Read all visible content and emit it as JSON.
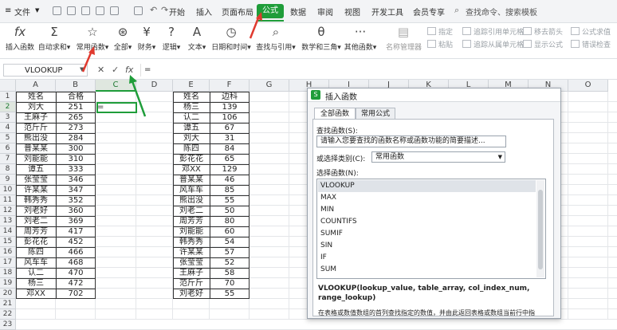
{
  "menu": {
    "file_label": "文件",
    "tabs": [
      "开始",
      "插入",
      "页面布局",
      "公式",
      "数据",
      "审阅",
      "视图",
      "开发工具",
      "会员专享"
    ],
    "search_placeholder": "查找命令、搜索模板"
  },
  "ribbon": {
    "buttons": [
      {
        "icon": "fx",
        "label": "插入函数"
      },
      {
        "icon": "Σ",
        "label": "自动求和▾"
      },
      {
        "icon": "☆",
        "label": "常用函数▾"
      },
      {
        "icon": "⊛",
        "label": "全部▾"
      },
      {
        "icon": "¥",
        "label": "财务▾"
      },
      {
        "icon": "?",
        "label": "逻辑▾"
      },
      {
        "icon": "A",
        "label": "文本▾"
      },
      {
        "icon": "◷",
        "label": "日期和时间▾"
      },
      {
        "icon": "⌕",
        "label": "查找与引用▾"
      },
      {
        "icon": "θ",
        "label": "数学和三角▾"
      },
      {
        "icon": "···",
        "label": "其他函数▾"
      },
      {
        "icon": "▤",
        "label": "名称管理器"
      }
    ],
    "small_buttons": [
      "指定",
      "追踪引用单元格",
      "移去箭头",
      "公式求值",
      "粘贴",
      "追踪从属单元格",
      "显示公式",
      "错误检查"
    ]
  },
  "formula_bar": {
    "name_box": "VLOOKUP",
    "cancel_symbol": "✕",
    "confirm_symbol": "✓",
    "fx_symbol": "fx",
    "content": "="
  },
  "columns": [
    "A",
    "B",
    "C",
    "D",
    "E",
    "F",
    "G",
    "H",
    "I",
    "J",
    "K",
    "L",
    "M",
    "N",
    "O"
  ],
  "rows": [
    "1",
    "2",
    "3",
    "4",
    "5",
    "6",
    "7",
    "8",
    "9",
    "10",
    "11",
    "12",
    "13",
    "14",
    "15",
    "16",
    "17",
    "18",
    "19",
    "20",
    "21",
    "22",
    "23"
  ],
  "table1": {
    "headers": [
      "姓名",
      "合格"
    ],
    "rows": [
      [
        "刘大",
        "251"
      ],
      [
        "王麻子",
        "265"
      ],
      [
        "范斤斤",
        "273"
      ],
      [
        "熊出没",
        "284"
      ],
      [
        "普某某",
        "300"
      ],
      [
        "刘能能",
        "310"
      ],
      [
        "谭五",
        "333"
      ],
      [
        "张莹莹",
        "346"
      ],
      [
        "许某某",
        "347"
      ],
      [
        "韩秀秀",
        "352"
      ],
      [
        "刘老好",
        "360"
      ],
      [
        "刘老二",
        "369"
      ],
      [
        "周芳芳",
        "417"
      ],
      [
        "彭花花",
        "452"
      ],
      [
        "陈四",
        "466"
      ],
      [
        "风车车",
        "468"
      ],
      [
        "认二",
        "470"
      ],
      [
        "杨三",
        "472"
      ],
      [
        "邓XX",
        "702"
      ]
    ]
  },
  "table2": {
    "headers": [
      "姓名",
      "边科"
    ],
    "rows": [
      [
        "杨三",
        "139"
      ],
      [
        "认二",
        "106"
      ],
      [
        "谭五",
        "67"
      ],
      [
        "刘大",
        "31"
      ],
      [
        "陈四",
        "84"
      ],
      [
        "彭花花",
        "65"
      ],
      [
        "邓XX",
        "129"
      ],
      [
        "普某某",
        "46"
      ],
      [
        "风车车",
        "85"
      ],
      [
        "熊出没",
        "55"
      ],
      [
        "刘老二",
        "50"
      ],
      [
        "周芳芳",
        "80"
      ],
      [
        "刘能能",
        "60"
      ],
      [
        "韩秀秀",
        "54"
      ],
      [
        "许某某",
        "57"
      ],
      [
        "张莹莹",
        "52"
      ],
      [
        "王麻子",
        "58"
      ],
      [
        "范斤斤",
        "70"
      ],
      [
        "刘老好",
        "55"
      ]
    ]
  },
  "active_cell_value": "=",
  "dialog": {
    "title": "插入函数",
    "tabs": [
      "全部函数",
      "常用公式"
    ],
    "search_label": "查找函数(S):",
    "search_value": "请输入您要查找的函数名称或函数功能的简要描述...",
    "category_label": "或选择类别(C):",
    "category_value": "常用函数",
    "select_label": "选择函数(N):",
    "functions": [
      "VLOOKUP",
      "MAX",
      "MIN",
      "COUNTIFS",
      "SUMIF",
      "SIN",
      "IF",
      "SUM"
    ],
    "signature": "VLOOKUP(lookup_value, table_array, col_index_num, range_lookup)",
    "description": "在表格或数值数组的首列查找指定的数值，并由此返回表格或数组当前行中指"
  },
  "colors": {
    "accent": "#1f9d3a",
    "arrow": "#e03a2f"
  }
}
